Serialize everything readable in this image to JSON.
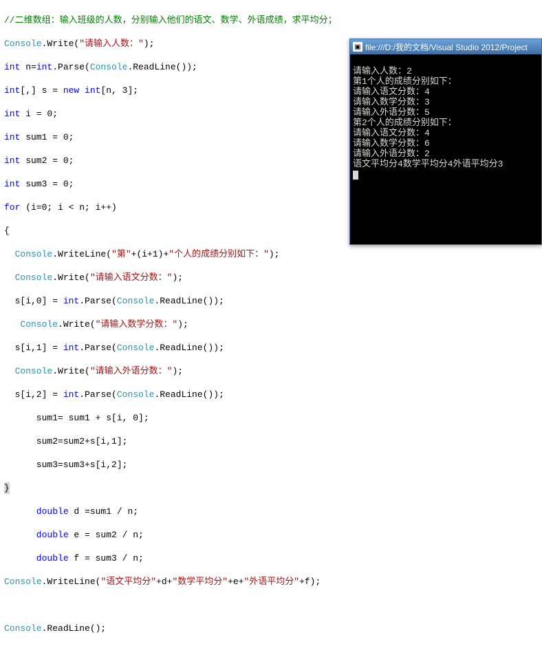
{
  "code": {
    "comment": "//二维数组：输入班级的人数，分别输入他们的语文、数学、外语成绩，求平均分；",
    "lines": {
      "l2_a": "Console",
      "l2_b": ".Write(",
      "l2_s": "\"请输入人数：\"",
      "l2_c": ");",
      "l3_a": "int",
      "l3_b": " n=",
      "l3_c": "int",
      "l3_d": ".Parse(",
      "l3_e": "Console",
      "l3_f": ".ReadLine());",
      "l4_a": "int",
      "l4_b": "[,] s = ",
      "l4_c": "new",
      "l4_d": " ",
      "l4_e": "int",
      "l4_f": "[n, 3];",
      "l5_a": "int",
      "l5_b": " i = 0;",
      "l6_a": "int",
      "l6_b": " sum1 = 0;",
      "l7_a": "int",
      "l7_b": " sum2 = 0;",
      "l8_a": "int",
      "l8_b": " sum3 = 0;",
      "l9_a": "for",
      "l9_b": " (i=0; i < n; i++)",
      "l10": "{",
      "l11_a": "  Console",
      "l11_b": ".WriteLine(",
      "l11_s1": "\"第\"",
      "l11_c": "+(i+1)+",
      "l11_s2": "\"个人的成绩分别如下：\"",
      "l11_d": ");",
      "l12_a": "  Console",
      "l12_b": ".Write(",
      "l12_s": "\"请输入语文分数：\"",
      "l12_c": ");",
      "l13_a": "  s[i,0] = ",
      "l13_b": "int",
      "l13_c": ".Parse(",
      "l13_d": "Console",
      "l13_e": ".ReadLine());",
      "l14_a": "   Console",
      "l14_b": ".Write(",
      "l14_s": "\"请输入数学分数：\"",
      "l14_c": ");",
      "l15_a": "  s[i,1] = ",
      "l15_b": "int",
      "l15_c": ".Parse(",
      "l15_d": "Console",
      "l15_e": ".ReadLine());",
      "l16_a": "  Console",
      "l16_b": ".Write(",
      "l16_s": "\"请输入外语分数：\"",
      "l16_c": ");",
      "l17_a": "  s[i,2] = ",
      "l17_b": "int",
      "l17_c": ".Parse(",
      "l17_d": "Console",
      "l17_e": ".ReadLine());",
      "l18": "      sum1= sum1 + s[i, 0];",
      "l19": "      sum2=sum2+s[i,1];",
      "l20": "      sum3=sum3+s[i,2];",
      "l21": "}",
      "l22_a": "      double",
      "l22_b": " d =sum1 / n;",
      "l23_a": "      double",
      "l23_b": " e = sum2 / n;",
      "l24_a": "      double",
      "l24_b": " f = sum3 / n;",
      "l25_a": "Console",
      "l25_b": ".WriteLine(",
      "l25_s1": "\"语文平均分\"",
      "l25_c": "+d+",
      "l25_s2": "\"数学平均分\"",
      "l25_d": "+e+",
      "l25_s3": "\"外语平均分\"",
      "l25_e": "+f);",
      "l27_a": "Console",
      "l27_b": ".ReadLine();"
    }
  },
  "console": {
    "title": "file:///D:/我的文档/Visual Studio 2012/Project",
    "output": {
      "o1": "请输入人数：2",
      "o2": "第1个人的成绩分别如下：",
      "o3": "请输入语文分数：4",
      "o4": "请输入数学分数：3",
      "o5": "请输入外语分数：5",
      "o6": "第2个人的成绩分别如下：",
      "o7": "请输入语文分数：4",
      "o8": "请输入数学分数：6",
      "o9": "请输入外语分数：2",
      "o10": "语文平均分4数学平均分4外语平均分3"
    }
  }
}
